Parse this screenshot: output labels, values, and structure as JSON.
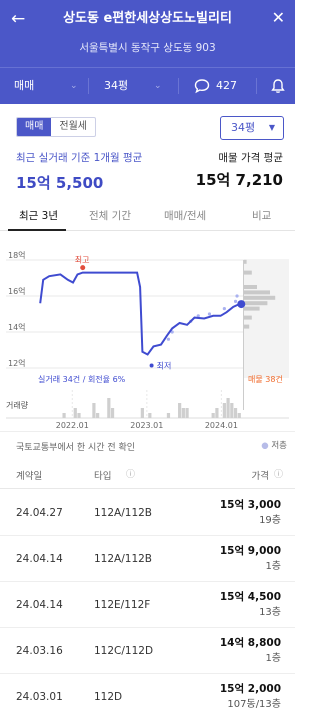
{
  "header": {
    "title": "상도동 e편한세상상도노빌리티",
    "address": "서울특별시 동작구 상도동 903",
    "filters": {
      "deal_type": "매매",
      "size": "34평",
      "comments": "427"
    }
  },
  "segment": {
    "options": [
      "매매",
      "전월세"
    ],
    "selected": "매매"
  },
  "size_button": "34평",
  "summary": {
    "left_label": "최근 실거래 기준 1개월 평균",
    "left_value": "15억 5,500",
    "right_label": "매물 가격 평균",
    "right_value": "15억 7,210"
  },
  "tabs": [
    "최근 3년",
    "전체 기간",
    "매매/전세",
    "비교"
  ],
  "chart_labels": {
    "high": "최고",
    "low": "최저",
    "bottom_left": "실거래 34건 / 회전율 6%",
    "bottom_right": "매물 38건",
    "volume": "거래량"
  },
  "chart_data": {
    "type": "line",
    "y_ticks": [
      "18억",
      "16억",
      "14억",
      "12억"
    ],
    "ylim": [
      12,
      18
    ],
    "x_ticks": [
      "2022.01",
      "2023.01",
      "2024.01"
    ],
    "series": [
      {
        "values": [
          [
            2021.58,
            15.6
          ],
          [
            2021.62,
            16.9
          ],
          [
            2021.7,
            17.1
          ],
          [
            2021.85,
            17.2
          ],
          [
            2021.95,
            16.9
          ],
          [
            2022.02,
            16.75
          ],
          [
            2022.08,
            17.2
          ],
          [
            2022.15,
            17.3
          ],
          [
            2022.25,
            17.3
          ],
          [
            2022.4,
            17.3
          ],
          [
            2022.6,
            17.3
          ],
          [
            2022.8,
            17.3
          ],
          [
            2022.88,
            17.3
          ],
          [
            2022.92,
            16.5
          ],
          [
            2022.95,
            12.9
          ],
          [
            2023.02,
            12.75
          ],
          [
            2023.1,
            13.2
          ],
          [
            2023.2,
            13.3
          ],
          [
            2023.28,
            13.8
          ],
          [
            2023.35,
            14.2
          ],
          [
            2023.45,
            14.5
          ],
          [
            2023.55,
            14.4
          ],
          [
            2023.65,
            14.8
          ],
          [
            2023.78,
            14.75
          ],
          [
            2023.9,
            14.9
          ],
          [
            2024.0,
            14.9
          ],
          [
            2024.08,
            15.1
          ],
          [
            2024.17,
            15.4
          ],
          [
            2024.25,
            15.55
          ]
        ]
      }
    ],
    "points": [
      [
        2023.6,
        14.6
      ],
      [
        2023.7,
        14.9
      ],
      [
        2023.85,
        15.0
      ],
      [
        2024.05,
        15.3
      ],
      [
        2024.2,
        15.7
      ],
      [
        2024.22,
        16.0
      ],
      [
        2023.3,
        13.6
      ],
      [
        2023.35,
        14.0
      ]
    ],
    "volume": [
      [
        2021.9,
        1
      ],
      [
        2022.05,
        2
      ],
      [
        2022.1,
        1
      ],
      [
        2022.3,
        3
      ],
      [
        2022.35,
        1
      ],
      [
        2022.5,
        4
      ],
      [
        2022.55,
        2
      ],
      [
        2022.95,
        2
      ],
      [
        2023.05,
        1
      ],
      [
        2023.3,
        1
      ],
      [
        2023.45,
        3
      ],
      [
        2023.5,
        2
      ],
      [
        2023.55,
        2
      ],
      [
        2023.9,
        1
      ],
      [
        2023.95,
        2
      ],
      [
        2024.05,
        3
      ],
      [
        2024.1,
        4
      ],
      [
        2024.15,
        3
      ],
      [
        2024.2,
        2
      ],
      [
        2024.25,
        1
      ]
    ],
    "asking_distribution": [
      [
        17.9,
        1
      ],
      [
        17.3,
        3
      ],
      [
        16.5,
        5
      ],
      [
        16.2,
        10
      ],
      [
        15.9,
        12
      ],
      [
        15.6,
        9
      ],
      [
        15.3,
        6
      ],
      [
        14.8,
        3
      ],
      [
        14.3,
        2
      ]
    ]
  },
  "notice": "국토교통부에서 한 시간 전 확인",
  "legend_right": "저층",
  "table": {
    "headers": [
      "계약일",
      "타입",
      "가격"
    ],
    "rows": [
      {
        "date": "24.04.27",
        "type": "112A/112B",
        "price": "15억 3,000",
        "floor": "19층"
      },
      {
        "date": "24.04.14",
        "type": "112A/112B",
        "price": "15억 9,000",
        "floor": "1층"
      },
      {
        "date": "24.04.14",
        "type": "112E/112F",
        "price": "15억 4,500",
        "floor": "13층"
      },
      {
        "date": "24.03.16",
        "type": "112C/112D",
        "price": "14억 8,800",
        "floor": "1층"
      },
      {
        "date": "24.03.01",
        "type": "112D",
        "price": "15억 2,000",
        "floor": "107동/13층"
      }
    ]
  },
  "colors": {
    "primary": "#4b57c8",
    "line": "#3f4bd0",
    "high_marker": "#e24d3c",
    "asking": "#f06a2b"
  }
}
